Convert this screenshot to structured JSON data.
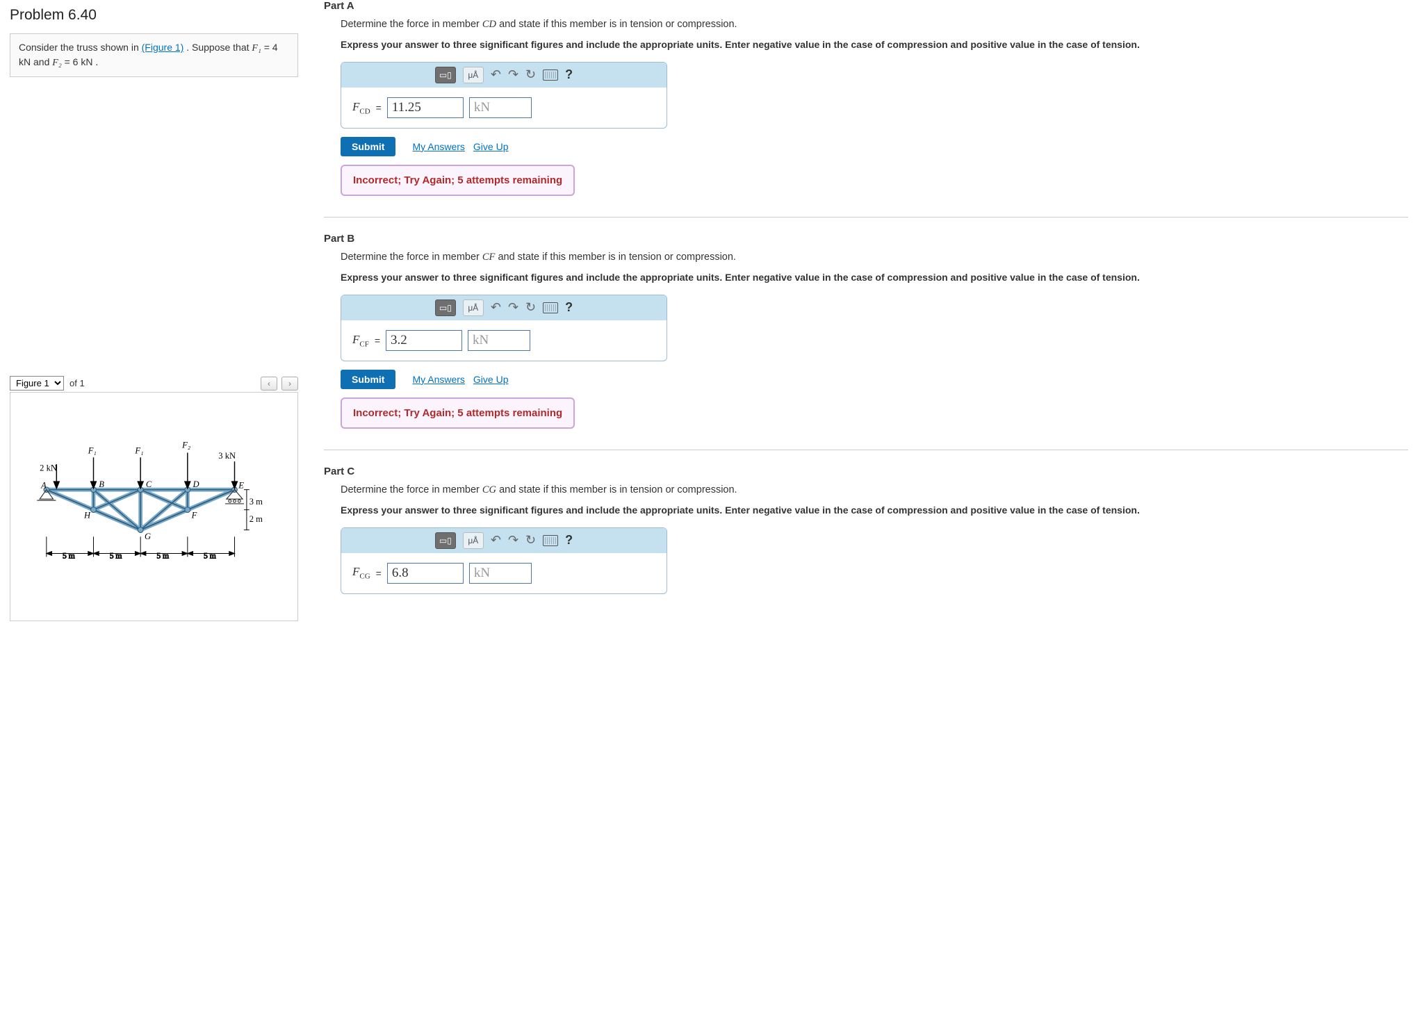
{
  "problem": {
    "title": "Problem 6.40",
    "description_pre": "Consider the truss shown in ",
    "figure_link": "(Figure 1)",
    "description_mid": " . Suppose that ",
    "f1_label": "F₁",
    "f1_eq": " = 4 ",
    "f1_unit": "kN",
    "and": " and ",
    "f2_label": "F₂",
    "f2_eq": " = 6 ",
    "f2_unit": "kN",
    "period": " ."
  },
  "figure_nav": {
    "selected": "Figure 1",
    "of_text": "of 1",
    "prev": "‹",
    "next": "›"
  },
  "figure_labels": {
    "F1": "F₁",
    "F2": "F₂",
    "load_left": "2 kN",
    "load_right": "3 kN",
    "A": "A",
    "B": "B",
    "C": "C",
    "D": "D",
    "E": "E",
    "F": "F",
    "G": "G",
    "H": "H",
    "dim_5m": "5 m",
    "dim_3m": "3 m",
    "dim_2m": "2 m"
  },
  "toolbar": {
    "templates": "▭▯",
    "units": "μÅ",
    "undo": "↶",
    "redo": "↷",
    "reset": "↻",
    "help": "?"
  },
  "common": {
    "eq": " = ",
    "submit": "Submit",
    "my_answers": "My Answers",
    "give_up": "Give Up"
  },
  "parts": {
    "A": {
      "title": "Part A",
      "question_pre": "Determine the force in member ",
      "member": "CD",
      "question_post": " and state if this member is in tension or compression.",
      "hint": "Express your answer to three significant figures and include the appropriate units. Enter negative value in the case of compression and positive value in the case of tension.",
      "var_html": "F<sub>CD</sub>",
      "value": "11.25",
      "unit": "kN",
      "feedback": "Incorrect; Try Again; 5 attempts remaining"
    },
    "B": {
      "title": "Part B",
      "question_pre": "Determine the force in member ",
      "member": "CF",
      "question_post": " and state if this member is in tension or compression.",
      "hint": "Express your answer to three significant figures and include the appropriate units. Enter negative value in the case of compression and positive value in the case of tension.",
      "var_html": "F<sub>CF</sub>",
      "value": "3.2",
      "unit": "kN",
      "feedback": "Incorrect; Try Again; 5 attempts remaining"
    },
    "C": {
      "title": "Part C",
      "question_pre": "Determine the force in member ",
      "member": "CG",
      "question_post": " and state if this member is in tension or compression.",
      "hint": "Express your answer to three significant figures and include the appropriate units. Enter negative value in the case of compression and positive value in the case of tension.",
      "var_html": "F<sub>CG</sub>",
      "value": "6.8",
      "unit": "kN"
    }
  }
}
